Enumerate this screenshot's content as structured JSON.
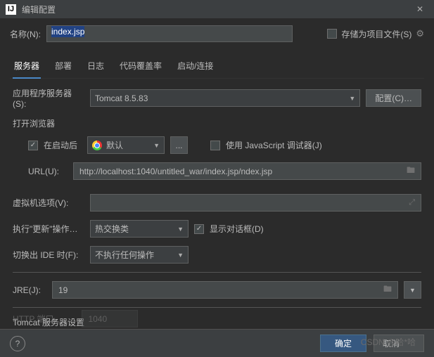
{
  "window": {
    "title": "编辑配置",
    "app_icon": "IJ"
  },
  "name": {
    "label": "名称(N):",
    "value": "index.jsp"
  },
  "store_as_project": {
    "label": "存储为项目文件(S)",
    "checked": false
  },
  "tabs": [
    {
      "id": "server",
      "label": "服务器",
      "active": true
    },
    {
      "id": "deploy",
      "label": "部署"
    },
    {
      "id": "logs",
      "label": "日志"
    },
    {
      "id": "coverage",
      "label": "代码覆盖率"
    },
    {
      "id": "startup",
      "label": "启动/连接"
    }
  ],
  "appserver": {
    "label": "应用程序服务器(S):",
    "value": "Tomcat 8.5.83",
    "config_btn": "配置(C)…"
  },
  "browser": {
    "section_title": "打开浏览器",
    "after_launch": {
      "label": "在启动后",
      "checked": true
    },
    "browser_select": "默认",
    "more_btn": "...",
    "js_debugger": {
      "label": "使用 JavaScript 调试器(J)",
      "checked": false
    },
    "url": {
      "label": "URL(U):",
      "value": "http://localhost:1040/untitled_war/index.jsp/ndex.jsp"
    }
  },
  "vm_options": {
    "label": "虚拟机选项(V):",
    "value": ""
  },
  "on_update": {
    "label": "执行\"更新\"操作…",
    "value": "热交换类",
    "show_dialog": {
      "label": "显示对话框(D)",
      "checked": true
    }
  },
  "on_frame": {
    "label": "切换出 IDE 时(F):",
    "value": "不执行任何操作"
  },
  "jre": {
    "label": "JRE(J):",
    "value": "19"
  },
  "tomcat_section": "Tomcat 服务器设置",
  "http_port": {
    "label": "HTTP 端口",
    "value": "1040"
  },
  "footer": {
    "ok": "确定",
    "cancel": "取消"
  },
  "watermark": "CSDN @哈*哈"
}
